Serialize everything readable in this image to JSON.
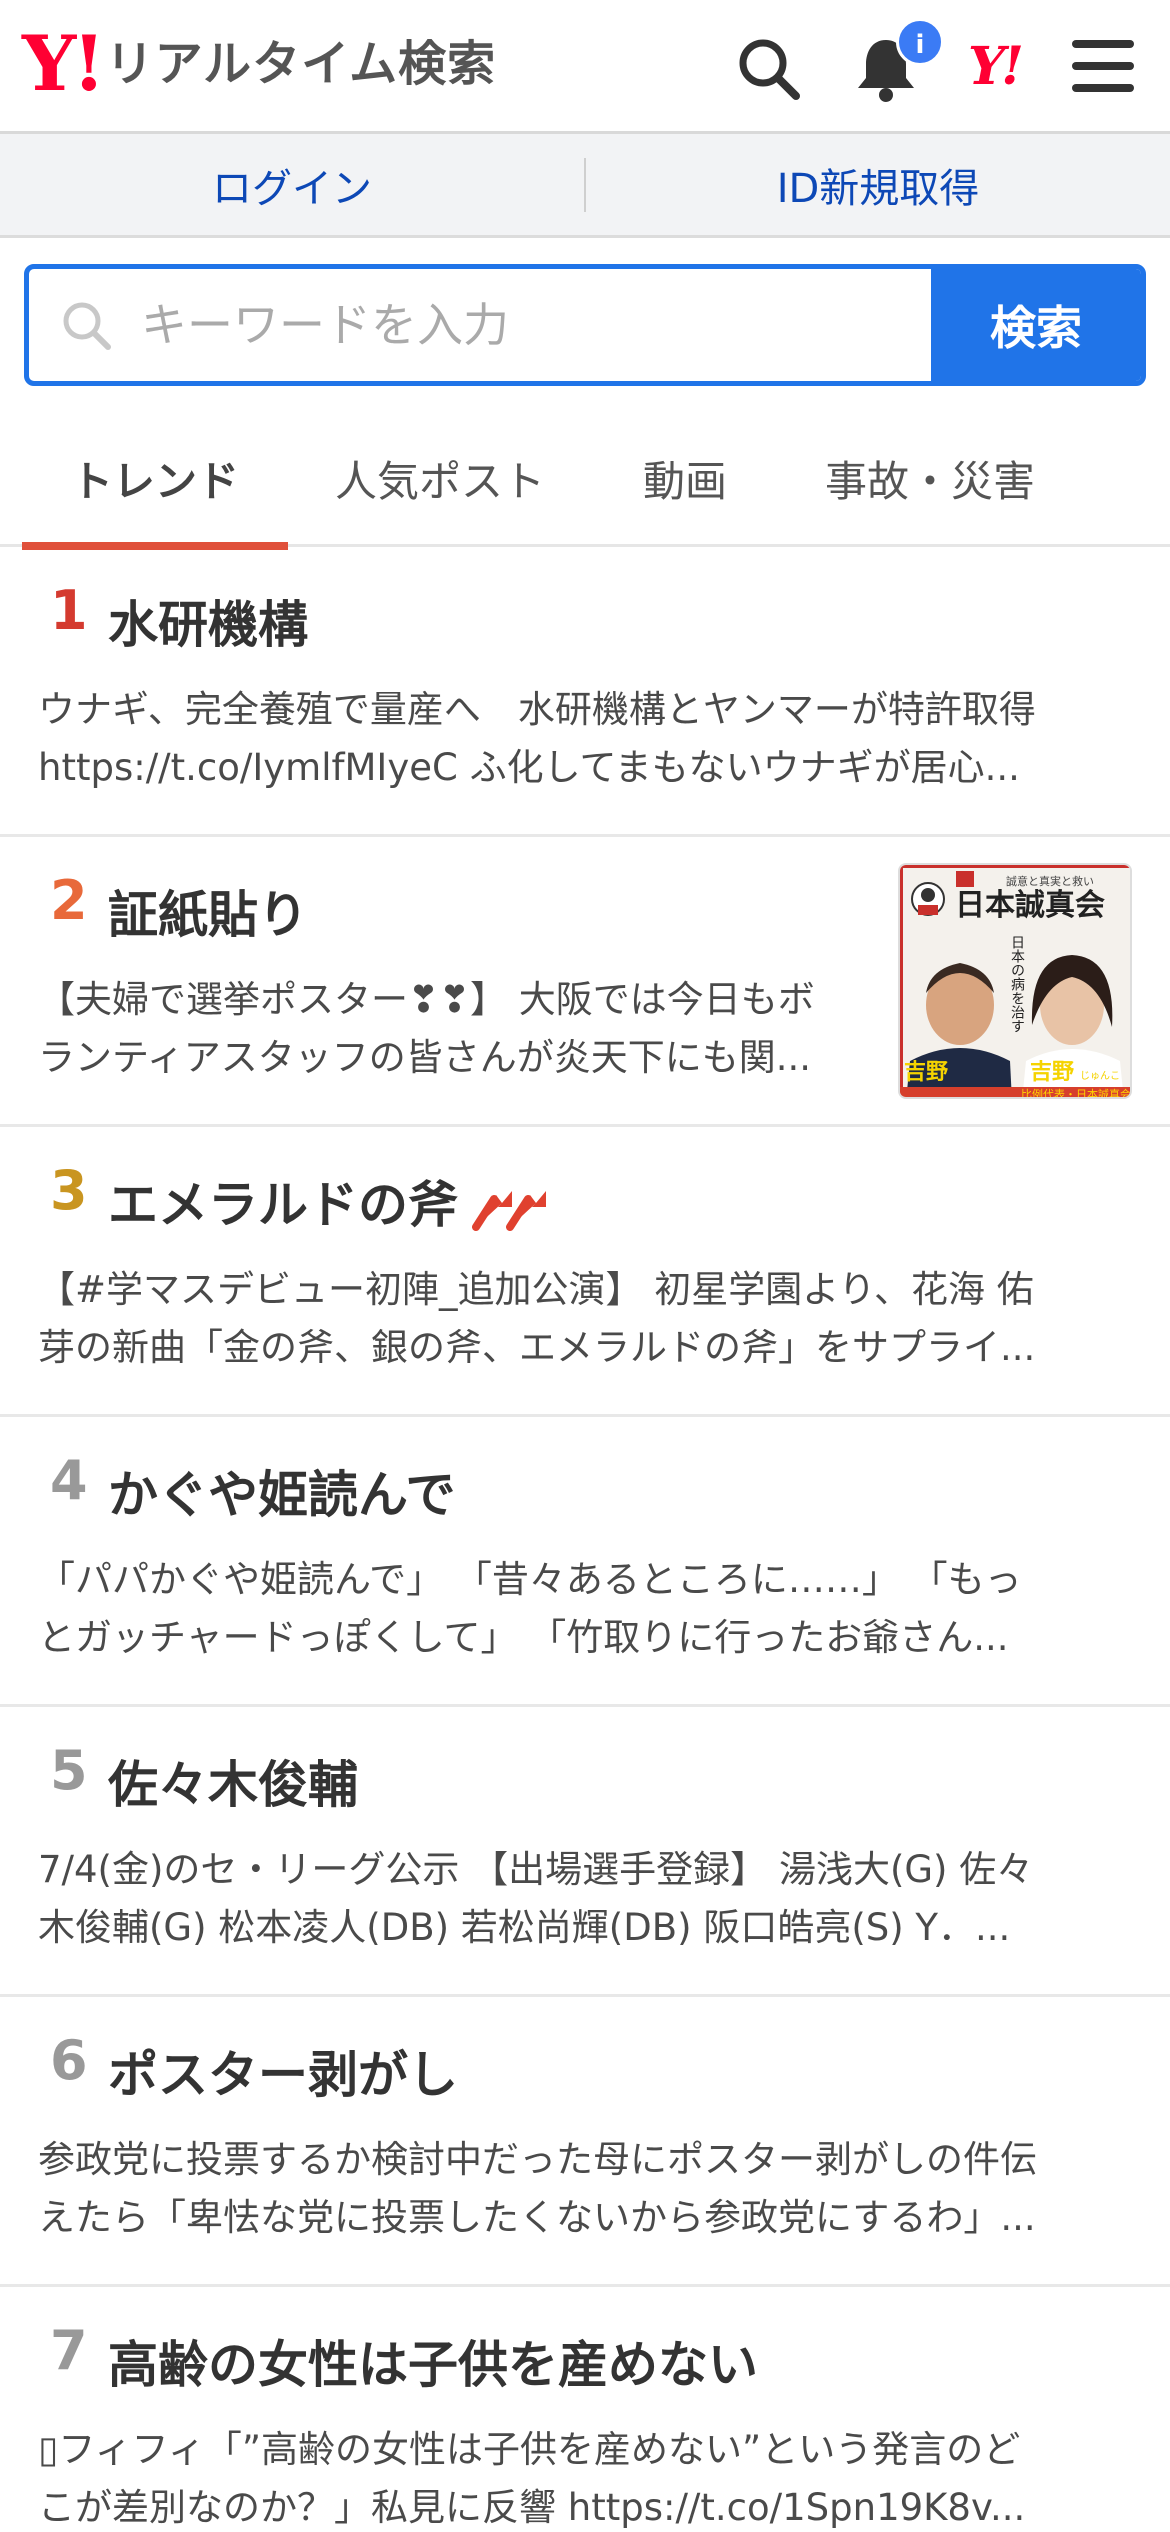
{
  "header": {
    "logo_y": "Y!",
    "logo_text": "リアルタイム検索",
    "notification_badge": "i",
    "yj_logo": "Y!",
    "icons": [
      "search-icon",
      "bell-icon",
      "yahoo-japan-icon",
      "menu-icon"
    ]
  },
  "account": {
    "login_label": "ログイン",
    "register_label": "ID新規取得"
  },
  "search": {
    "placeholder": "キーワードを入力",
    "value": "",
    "button_label": "検索"
  },
  "tabs": [
    {
      "label": "トレンド",
      "active": true
    },
    {
      "label": "人気ポスト",
      "active": false
    },
    {
      "label": "動画",
      "active": false
    },
    {
      "label": "事故・災害",
      "active": false
    }
  ],
  "trends": [
    {
      "rank": "1",
      "rank_color": "#d43a2f",
      "title": "水研機構",
      "lines": [
        "ウナギ、完全養殖で量産へ　水研機構とヤンマーが特許取得",
        "https://t.co/IymlfMIyeC ふ化してまもないウナギが居心..."
      ]
    },
    {
      "rank": "2",
      "rank_color": "#e8693a",
      "title": "証紙貼り",
      "lines": [
        "【夫婦で選挙ポスター❣❣】 大阪では今日もボ",
        "ランティアスタッフの皆さんが炎天下にも関..."
      ],
      "thumbnail": {
        "headline": "日本誠真会",
        "tagline": "誠意と真実と救い",
        "vertical": "日本の病を治す",
        "names": [
          "吉野",
          "吉野"
        ],
        "furigana": "じゅんこ",
        "caption": "比例代表・日本誠真会"
      }
    },
    {
      "rank": "3",
      "rank_color": "#c99520",
      "title": "エメラルドの斧",
      "rising": true,
      "lines": [
        "【#学マスデビュー初陣_追加公演】 初星学園より、花海 佑",
        "芽の新曲「金の斧、銀の斧、エメラルドの斧」をサプライ..."
      ]
    },
    {
      "rank": "4",
      "rank_color": "#999999",
      "title": "かぐや姫読んで",
      "lines": [
        "「パパかぐや姫読んで」 「昔々あるところに……」 「もっ",
        "とガッチャードっぽくして」 「竹取りに行ったお爺さん..."
      ]
    },
    {
      "rank": "5",
      "rank_color": "#999999",
      "title": "佐々木俊輔",
      "lines": [
        "7/4(金)のセ・リーグ公示 【出場選手登録】 湯浅大(G) 佐々",
        "木俊輔(G) 松本凌人(DB) 若松尚輝(DB) 阪口皓亮(S) Y．..."
      ]
    },
    {
      "rank": "6",
      "rank_color": "#999999",
      "title": "ポスター剥がし",
      "lines": [
        "参政党に投票するか検討中だった母にポスター剥がしの件伝",
        "えたら「卑怯な党に投票したくないから参政党にするわ」..."
      ]
    },
    {
      "rank": "7",
      "rank_color": "#999999",
      "title": "高齢の女性は子供を産めない",
      "lines": [
        "▯フィフィ「”高齢の女性は子供を産めない”という発言のど",
        "こが差別なのか？」私見に反響 https://t.co/1Spn19K8v..."
      ]
    }
  ]
}
